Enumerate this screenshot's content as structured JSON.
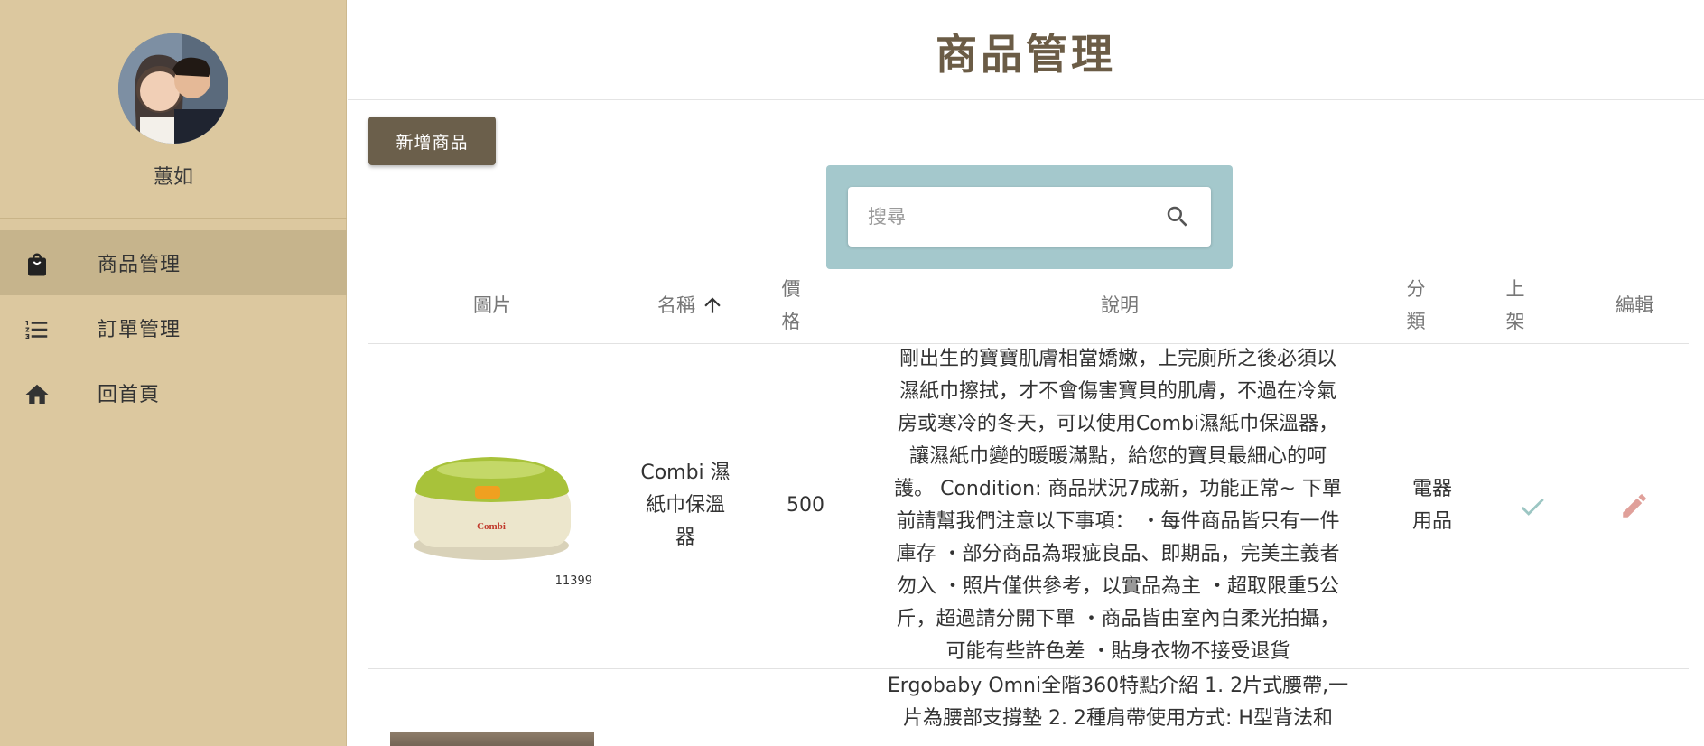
{
  "sidebar": {
    "user_name": "蕙如",
    "items": [
      {
        "label": "商品管理",
        "icon": "shopping-bag-icon",
        "active": true
      },
      {
        "label": "訂單管理",
        "icon": "list-icon",
        "active": false
      },
      {
        "label": "回首頁",
        "icon": "home-icon",
        "active": false
      }
    ]
  },
  "header": {
    "title": "商品管理"
  },
  "toolbar": {
    "add_label": "新增商品"
  },
  "search": {
    "placeholder": "搜尋"
  },
  "table": {
    "columns": {
      "image": "圖片",
      "name": "名稱",
      "price_1": "價",
      "price_2": "格",
      "description": "說明",
      "category_1": "分",
      "category_2": "類",
      "published_1": "上",
      "published_2": "架",
      "edit": "編輯"
    },
    "rows": [
      {
        "image_caption": "11399",
        "name_lines": [
          "Combi 濕",
          "紙巾保溫",
          "器"
        ],
        "price": "500",
        "description_lines": [
          "剛出生的寶寶肌膚相當嬌嫩，上完廁所之後必須以",
          "濕紙巾擦拭，才不會傷害寶貝的肌膚，不過在冷氣",
          "房或寒冷的冬天，可以使用Combi濕紙巾保溫器，",
          "讓濕紙巾變的暖暖滿點，給您的寶貝最細心的呵",
          "護。 Condition: 商品狀況7成新，功能正常~ 下單",
          "前請幫我們注意以下事項： ・每件商品皆只有一件",
          "庫存 ・部分商品為瑕疵良品、即期品，完美主義者",
          "勿入 ・照片僅供參考，以實品為主 ・超取限重5公",
          "斤，超過請分開下單 ・商品皆由室內白柔光拍攝，",
          "可能有些許色差 ・貼身衣物不接受退貨"
        ],
        "category_lines": [
          "電器",
          "用品"
        ],
        "published": true
      },
      {
        "description_lines": [
          "Ergobaby Omni全階360特點介紹 1. 2片式腰帶,一",
          "片為腰部支撐墊 2. 2種肩帶使用方式: H型背法和"
        ]
      }
    ]
  },
  "colors": {
    "sidebar_bg": "#dcc89f",
    "sidebar_active": "#c6b48c",
    "title": "#6b5c46",
    "button": "#6b5f4b",
    "search_panel": "#a4c8cc",
    "check": "#9cc6c3",
    "edit": "#e0a09a"
  }
}
